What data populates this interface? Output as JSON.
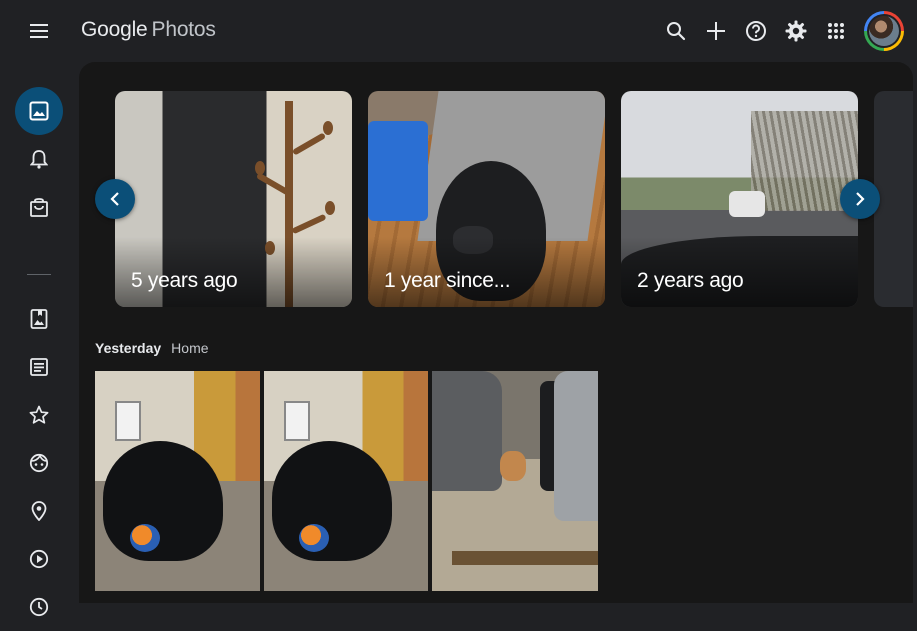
{
  "app": {
    "logo_google": "Google",
    "logo_photos": "Photos"
  },
  "topbar": {
    "icons": [
      "menu-icon",
      "search-icon",
      "add-icon",
      "help-icon",
      "settings-icon",
      "apps-grid-icon",
      "account-avatar"
    ]
  },
  "sidebar": {
    "items": [
      {
        "name": "photos",
        "icon": "image-icon",
        "active": true
      },
      {
        "name": "updates",
        "icon": "bell-icon"
      },
      {
        "name": "print-store",
        "icon": "shopping-bag-icon"
      },
      {
        "name": "albums",
        "icon": "photo-album-icon"
      },
      {
        "name": "documents",
        "icon": "document-icon"
      },
      {
        "name": "favorites",
        "icon": "star-icon"
      },
      {
        "name": "people",
        "icon": "face-icon"
      },
      {
        "name": "places",
        "icon": "location-pin-icon"
      },
      {
        "name": "videos",
        "icon": "play-circle-icon"
      }
    ]
  },
  "memories": {
    "items": [
      {
        "label": "5 years ago"
      },
      {
        "label": "1 year since..."
      },
      {
        "label": "2 years ago"
      }
    ]
  },
  "section": {
    "date": "Yesterday",
    "location": "Home"
  },
  "colors": {
    "background": "#202124",
    "panel": "#171717",
    "accent": "#0b4f78"
  }
}
